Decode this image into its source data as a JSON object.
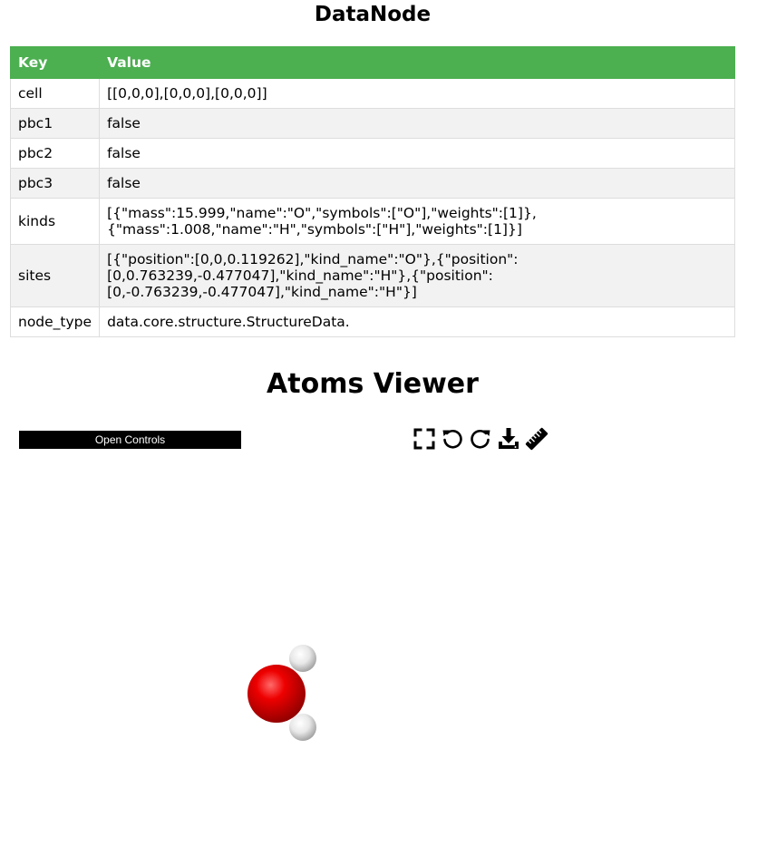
{
  "header": {
    "title": "DataNode"
  },
  "table": {
    "headers": {
      "key": "Key",
      "value": "Value"
    },
    "rows": [
      {
        "key": "cell",
        "value": "[[0,0,0],[0,0,0],[0,0,0]]"
      },
      {
        "key": "pbc1",
        "value": "false"
      },
      {
        "key": "pbc2",
        "value": "false"
      },
      {
        "key": "pbc3",
        "value": "false"
      },
      {
        "key": "kinds",
        "value": "[{\"mass\":15.999,\"name\":\"O\",\"symbols\":[\"O\"],\"weights\":[1]},{\"mass\":1.008,\"name\":\"H\",\"symbols\":[\"H\"],\"weights\":[1]}]"
      },
      {
        "key": "sites",
        "value": "[{\"position\":[0,0,0.119262],\"kind_name\":\"O\"},{\"position\":[0,0.763239,-0.477047],\"kind_name\":\"H\"},{\"position\":[0,-0.763239,-0.477047],\"kind_name\":\"H\"}]"
      },
      {
        "key": "node_type",
        "value": "data.core.structure.StructureData."
      }
    ]
  },
  "viewer": {
    "title": "Atoms Viewer",
    "controls_label": "Open Controls",
    "toolbar_icons": [
      "fullscreen-icon",
      "rotate-left-icon",
      "rotate-right-icon",
      "download-icon",
      "ruler-icon"
    ],
    "atom_colors": {
      "O": "#ff0000",
      "H": "#ffffff"
    }
  },
  "colors": {
    "table_header": "#4caf50",
    "row_alt": "#f2f2f2"
  }
}
